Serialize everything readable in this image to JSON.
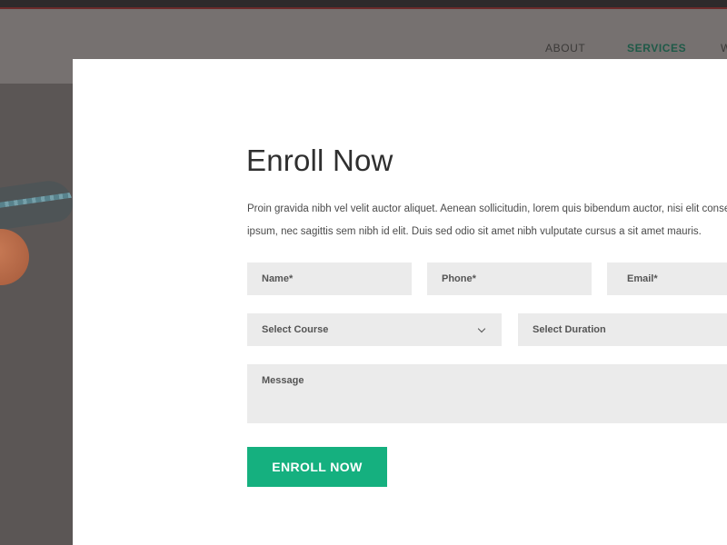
{
  "nav": {
    "items": [
      {
        "label": "ABOUT"
      },
      {
        "label": "SERVICES"
      },
      {
        "label": "W"
      }
    ],
    "active_color": "#1f5a48"
  },
  "modal": {
    "title": "Enroll Now",
    "description_lines": [
      "Proin gravida nibh vel velit auctor aliquet. Aenean sollicitudin, lorem quis bibendum auctor, nisi elit consequat",
      "ipsum, nec sagittis sem nibh id elit. Duis sed odio sit amet nibh vulputate cursus a sit amet mauris."
    ],
    "fields": {
      "name_placeholder": "Name*",
      "phone_placeholder": "Phone*",
      "email_placeholder": "Email*",
      "course_select": "Select Course",
      "duration_select": "Select Duration",
      "message_placeholder": "Message"
    },
    "submit_label": "ENROLL NOW",
    "accent_color": "#15b07f"
  },
  "icons": {
    "course_dropdown": "chevron-down-icon"
  }
}
